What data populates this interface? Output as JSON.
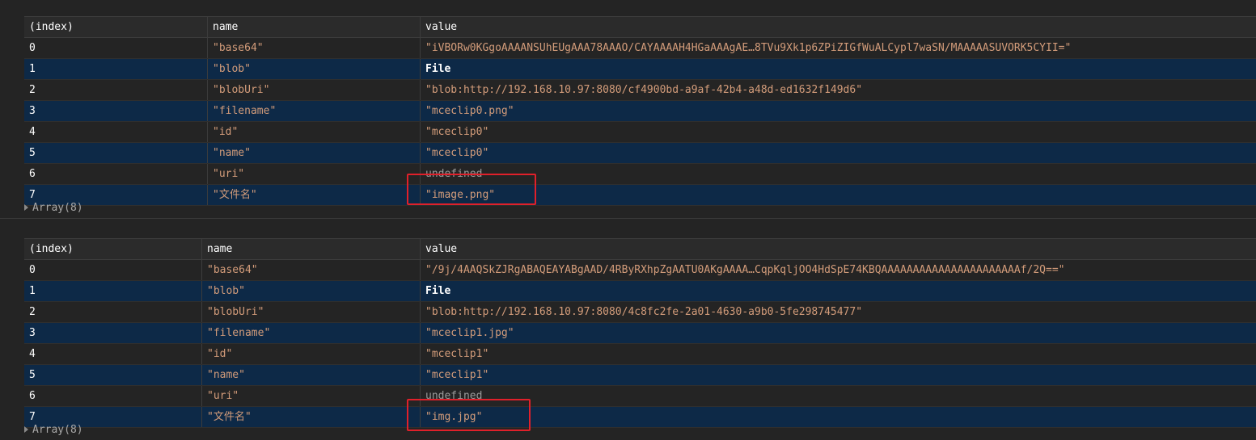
{
  "tables": [
    {
      "headers": {
        "index": "(index)",
        "name": "name",
        "value": "value"
      },
      "rows": [
        {
          "index": "0",
          "name": "\"base64\"",
          "value": "\"iVBORw0KGgoAAAANSUhEUgAAA78AAAO/CAYAAAAH4HGaAAAgAE…8TVu9Xk1p6ZPiZIGfWuALCypl7waSN/MAAAAASUVORK5CYII=\""
        },
        {
          "index": "1",
          "name": "\"blob\"",
          "value": "File"
        },
        {
          "index": "2",
          "name": "\"blobUri\"",
          "value": "\"blob:http://192.168.10.97:8080/cf4900bd-a9af-42b4-a48d-ed1632f149d6\""
        },
        {
          "index": "3",
          "name": "\"filename\"",
          "value": "\"mceclip0.png\""
        },
        {
          "index": "4",
          "name": "\"id\"",
          "value": "\"mceclip0\""
        },
        {
          "index": "5",
          "name": "\"name\"",
          "value": "\"mceclip0\""
        },
        {
          "index": "6",
          "name": "\"uri\"",
          "value": "undefined"
        },
        {
          "index": "7",
          "name": "\"文件名\"",
          "value": "\"image.png\""
        }
      ],
      "summary": "Array(8)"
    },
    {
      "headers": {
        "index": "(index)",
        "name": "name",
        "value": "value"
      },
      "rows": [
        {
          "index": "0",
          "name": "\"base64\"",
          "value": "\"/9j/4AAQSkZJRgABAQEAYABgAAD/4RByRXhpZgAATU0AKgAAAA…CqpKqljOO4HdSpE74KBQAAAAAAAAAAAAAAAAAAAAAAf/2Q==\""
        },
        {
          "index": "1",
          "name": "\"blob\"",
          "value": "File"
        },
        {
          "index": "2",
          "name": "\"blobUri\"",
          "value": "\"blob:http://192.168.10.97:8080/4c8fc2fe-2a01-4630-a9b0-5fe298745477\""
        },
        {
          "index": "3",
          "name": "\"filename\"",
          "value": "\"mceclip1.jpg\""
        },
        {
          "index": "4",
          "name": "\"id\"",
          "value": "\"mceclip1\""
        },
        {
          "index": "5",
          "name": "\"name\"",
          "value": "\"mceclip1\""
        },
        {
          "index": "6",
          "name": "\"uri\"",
          "value": "undefined"
        },
        {
          "index": "7",
          "name": "\"文件名\"",
          "value": "\"img.jpg\""
        }
      ],
      "summary": "Array(8)"
    }
  ],
  "colors": {
    "background": "#242424",
    "row_alt": "#0d2947",
    "string": "#d39c7a",
    "highlight": "#e0202a"
  }
}
